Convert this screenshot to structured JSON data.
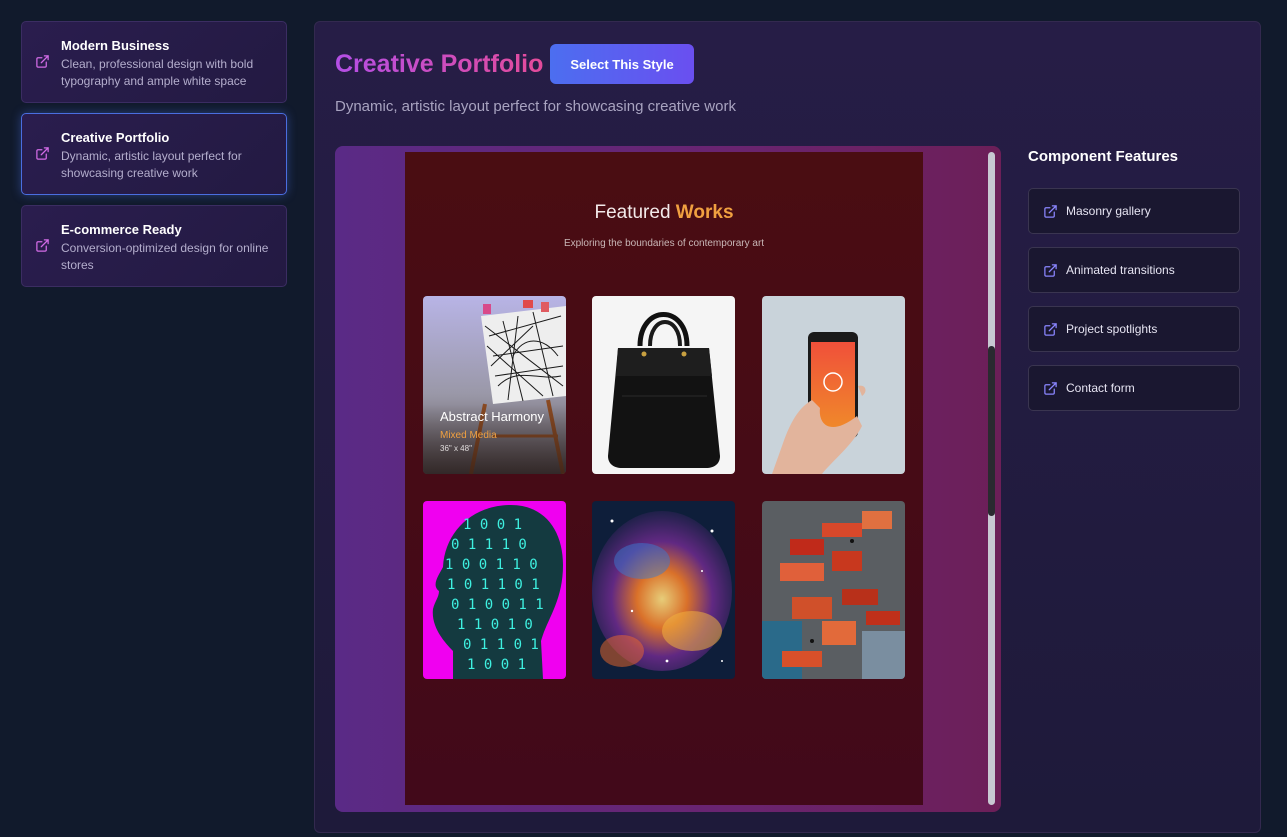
{
  "sidebar": {
    "items": [
      {
        "title": "Modern Business",
        "description": "Clean, professional design with bold typography and ample white space",
        "icon": "external-link-icon"
      },
      {
        "title": "Creative Portfolio",
        "description": "Dynamic, artistic layout perfect for showcasing creative work",
        "icon": "external-link-icon",
        "active": true
      },
      {
        "title": "E-commerce Ready",
        "description": "Conversion-optimized design for online stores",
        "icon": "external-link-icon"
      }
    ]
  },
  "main": {
    "title": "Creative Portfolio",
    "select_button": "Select This Style",
    "description": "Dynamic, artistic layout perfect for showcasing creative work"
  },
  "preview": {
    "title_prefix": "Featured",
    "title_accent": "Works",
    "subtitle": "Exploring the boundaries of contemporary art",
    "tiles": [
      {
        "name": "abstract-artwork-easel",
        "caption_title": "Abstract Harmony",
        "caption_medium": "Mixed Media",
        "caption_dimensions": "36\" x 48\""
      },
      {
        "name": "black-handbag"
      },
      {
        "name": "hand-holding-phone"
      },
      {
        "name": "binary-head-silhouette"
      },
      {
        "name": "cosmic-nebula"
      },
      {
        "name": "abstract-paint-strokes"
      }
    ]
  },
  "features": {
    "title": "Component Features",
    "items": [
      {
        "label": "Masonry gallery",
        "icon": "external-link-icon"
      },
      {
        "label": "Animated transitions",
        "icon": "external-link-icon"
      },
      {
        "label": "Project spotlights",
        "icon": "external-link-icon"
      },
      {
        "label": "Contact form",
        "icon": "external-link-icon"
      }
    ]
  },
  "colors": {
    "background": "#111a2c",
    "accent_purple": "#b44fe6",
    "accent_pink": "#e44b9a",
    "button_blue": "#4c6ef0",
    "preview_accent": "#f0a040",
    "active_border": "#4a6ee0"
  }
}
